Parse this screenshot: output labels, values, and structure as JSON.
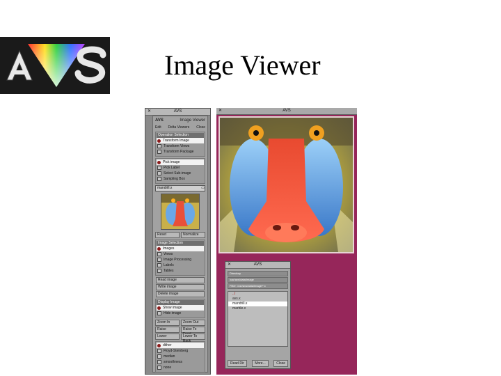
{
  "slide": {
    "title": "Image Viewer",
    "logo_text": "AVS"
  },
  "control_panel": {
    "window_title": "AVS",
    "brand": "AVS",
    "app_name": "Image Viewer",
    "menu": [
      "Edit",
      "Delta Viewers",
      "Close"
    ],
    "groups": [
      {
        "title": "Operation Selection",
        "rows": [
          {
            "label": "Transform Image",
            "kind": "radio",
            "selected": true
          },
          {
            "label": "Transform Views",
            "kind": "check",
            "selected": false
          },
          {
            "label": "Transform Package",
            "kind": "check",
            "selected": false
          }
        ]
      },
      {
        "title": "",
        "rows": [
          {
            "label": "Pick image",
            "kind": "radio",
            "selected": true
          },
          {
            "label": "Pick Label",
            "kind": "check",
            "selected": false
          },
          {
            "label": "Select Sub-image",
            "kind": "check",
            "selected": false
          },
          {
            "label": "Sampling Box",
            "kind": "check",
            "selected": false
          }
        ]
      }
    ],
    "image_field": "mandrill.x",
    "thumb_buttons": [
      "Reset",
      "Normalize"
    ],
    "view_group": {
      "title": "Image Selection",
      "rows": [
        {
          "label": "Images",
          "kind": "radio",
          "selected": true
        },
        {
          "label": "Views",
          "kind": "check",
          "selected": false
        },
        {
          "label": "Image Processing",
          "kind": "check",
          "selected": false
        },
        {
          "label": "Labels",
          "kind": "check",
          "selected": false
        },
        {
          "label": "Tables",
          "kind": "check",
          "selected": false
        }
      ]
    },
    "image_buttons": [
      "Read image",
      "Write image",
      "Delete image"
    ],
    "display_group": {
      "title": "Display Image",
      "rows": [
        {
          "label": "Show image",
          "kind": "radio",
          "selected": true
        },
        {
          "label": "Hide image",
          "kind": "check",
          "selected": false
        }
      ]
    },
    "zoom_buttons": [
      "Zoom In",
      "Zoom Out"
    ],
    "raise_buttons": [
      "Raise",
      "Raise To Front"
    ],
    "lower_buttons": [
      "Lower",
      "Lower To Back"
    ],
    "interp_rows": [
      {
        "label": "dither",
        "kind": "radio",
        "selected": true
      },
      {
        "label": "Floyd-Steinberg",
        "kind": "check",
        "selected": false
      },
      {
        "label": "median",
        "kind": "check",
        "selected": false
      },
      {
        "label": "smoothness",
        "kind": "check",
        "selected": false
      },
      {
        "label": "none",
        "kind": "check",
        "selected": false
      }
    ]
  },
  "image_window": {
    "title": "AVS"
  },
  "file_browser": {
    "title": "AVS",
    "lines": [
      "Directory",
      "/usr/avs/data/image",
      "Filter: /usr/avs/data/image/*.x"
    ],
    "items": [
      {
        "label": "../",
        "style": "red"
      },
      {
        "label": "avs.x",
        "style": ""
      },
      {
        "label": "mandrill.x",
        "style": "sel"
      },
      {
        "label": "marble.x",
        "style": ""
      }
    ],
    "buttons": [
      "Read Dir",
      "More...",
      "Close"
    ]
  },
  "colors": {
    "image_window_bg": "#96265a",
    "panel_bg": "#a2a2a2",
    "radio_dot": "#8b1a1a"
  }
}
